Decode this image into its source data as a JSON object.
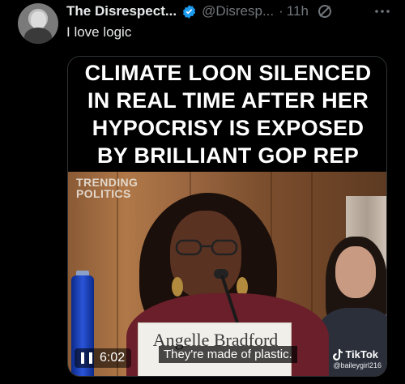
{
  "post": {
    "author_name": "The Disrespect...",
    "handle": "@Disresp...",
    "separator": "·",
    "timestamp": "11h",
    "text": "I love logic"
  },
  "media": {
    "headline": "CLIMATE LOON SILENCED\nIN REAL TIME AFTER HER\nHYPOCRISY IS EXPOSED\nBY BRILLIANT GOP REP",
    "watermark": "TRENDING\nPOLITICS",
    "nameplate": "Angelle Bradford",
    "caption": "They're made of plastic.",
    "timecode": "6:02",
    "tiktok_brand": "TikTok",
    "tiktok_user": "@baileygirl216"
  },
  "colors": {
    "verified_badge": "#1d9bf0",
    "background": "#000000",
    "secondary_text": "#71767b"
  },
  "icons": {
    "verified": "verified-badge-icon",
    "grok": "grok-icon",
    "more": "more-icon",
    "pause": "pause-icon",
    "tiktok": "tiktok-note-icon"
  }
}
